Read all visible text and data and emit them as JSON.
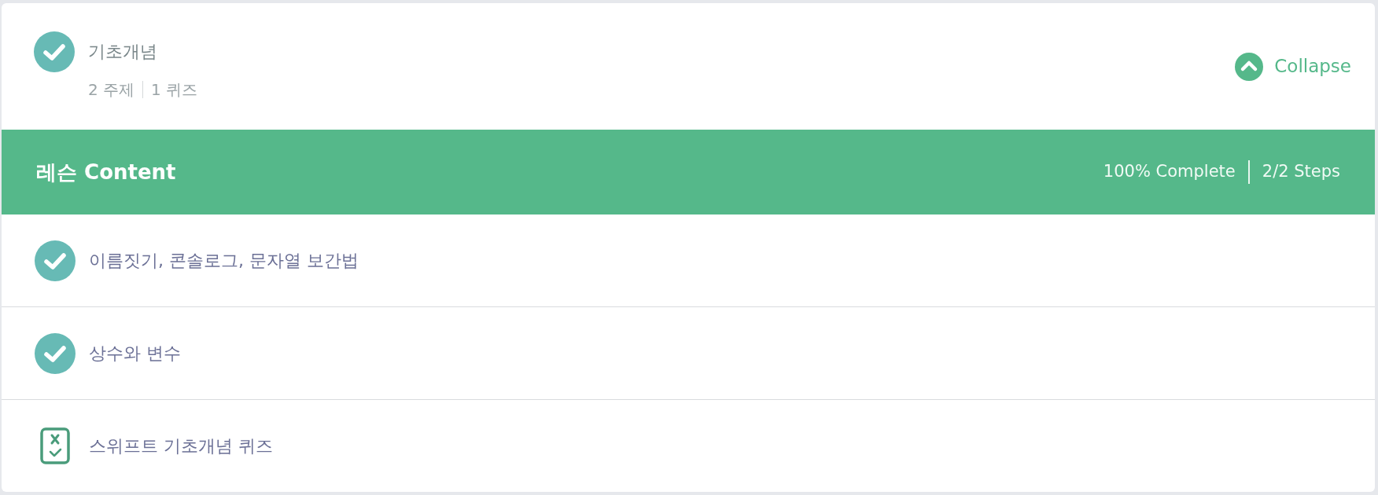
{
  "section": {
    "title": "기초개념",
    "completed": true,
    "topics": "2 주제",
    "quizzes": "1 퀴즈",
    "toggle": {
      "label": "Collapse",
      "expanded": true
    }
  },
  "lesson_bar": {
    "title": "레슨 Content",
    "progress": "100% Complete",
    "steps": "2/2 Steps"
  },
  "items": [
    {
      "kind": "topic",
      "title": "이름짓기, 콘솔로그, 문자열 보간법",
      "completed": true
    },
    {
      "kind": "topic",
      "title": "상수와 변수",
      "completed": true
    },
    {
      "kind": "quiz",
      "title": "스위프트 기초개념 퀴즈"
    }
  ]
}
